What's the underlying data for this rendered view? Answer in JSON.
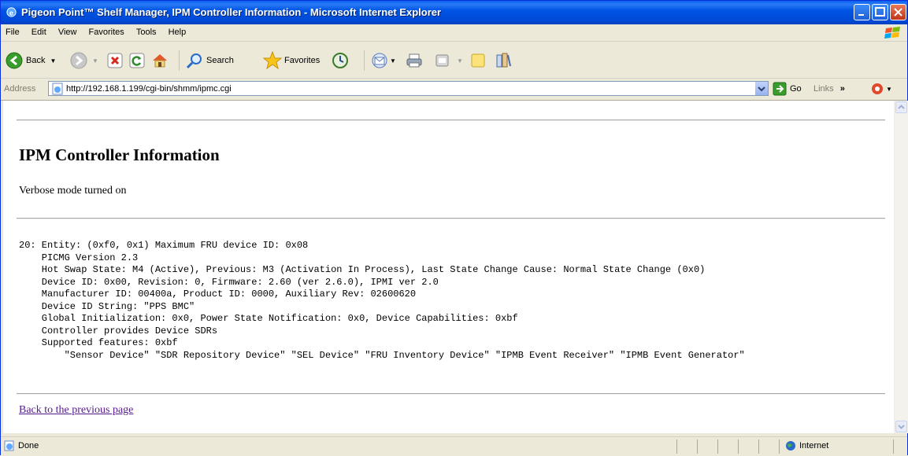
{
  "window": {
    "title": "Pigeon Point™ Shelf Manager, IPM Controller Information - Microsoft Internet Explorer"
  },
  "menu": [
    "File",
    "Edit",
    "View",
    "Favorites",
    "Tools",
    "Help"
  ],
  "toolbar": {
    "back": "Back",
    "search": "Search",
    "favorites": "Favorites"
  },
  "address": {
    "label": "Address",
    "url": "http://192.168.1.199/cgi-bin/shmm/ipmc.cgi",
    "go": "Go",
    "links": "Links"
  },
  "page": {
    "heading": "IPM Controller Information",
    "verbose": "Verbose mode turned on",
    "lines": [
      "20: Entity: (0xf0, 0x1) Maximum FRU device ID: 0x08",
      "    PICMG Version 2.3",
      "    Hot Swap State: M4 (Active), Previous: M3 (Activation In Process), Last State Change Cause: Normal State Change (0x0)",
      "    Device ID: 0x00, Revision: 0, Firmware: 2.60 (ver 2.6.0), IPMI ver 2.0",
      "    Manufacturer ID: 00400a, Product ID: 0000, Auxiliary Rev: 02600620",
      "    Device ID String: \"PPS BMC\"",
      "    Global Initialization: 0x0, Power State Notification: 0x0, Device Capabilities: 0xbf",
      "    Controller provides Device SDRs",
      "    Supported features: 0xbf",
      "        \"Sensor Device\" \"SDR Repository Device\" \"SEL Device\" \"FRU Inventory Device\" \"IPMB Event Receiver\" \"IPMB Event Generator\""
    ],
    "back_link": "Back to the previous page"
  },
  "status": {
    "left": "Done",
    "zone": "Internet"
  }
}
